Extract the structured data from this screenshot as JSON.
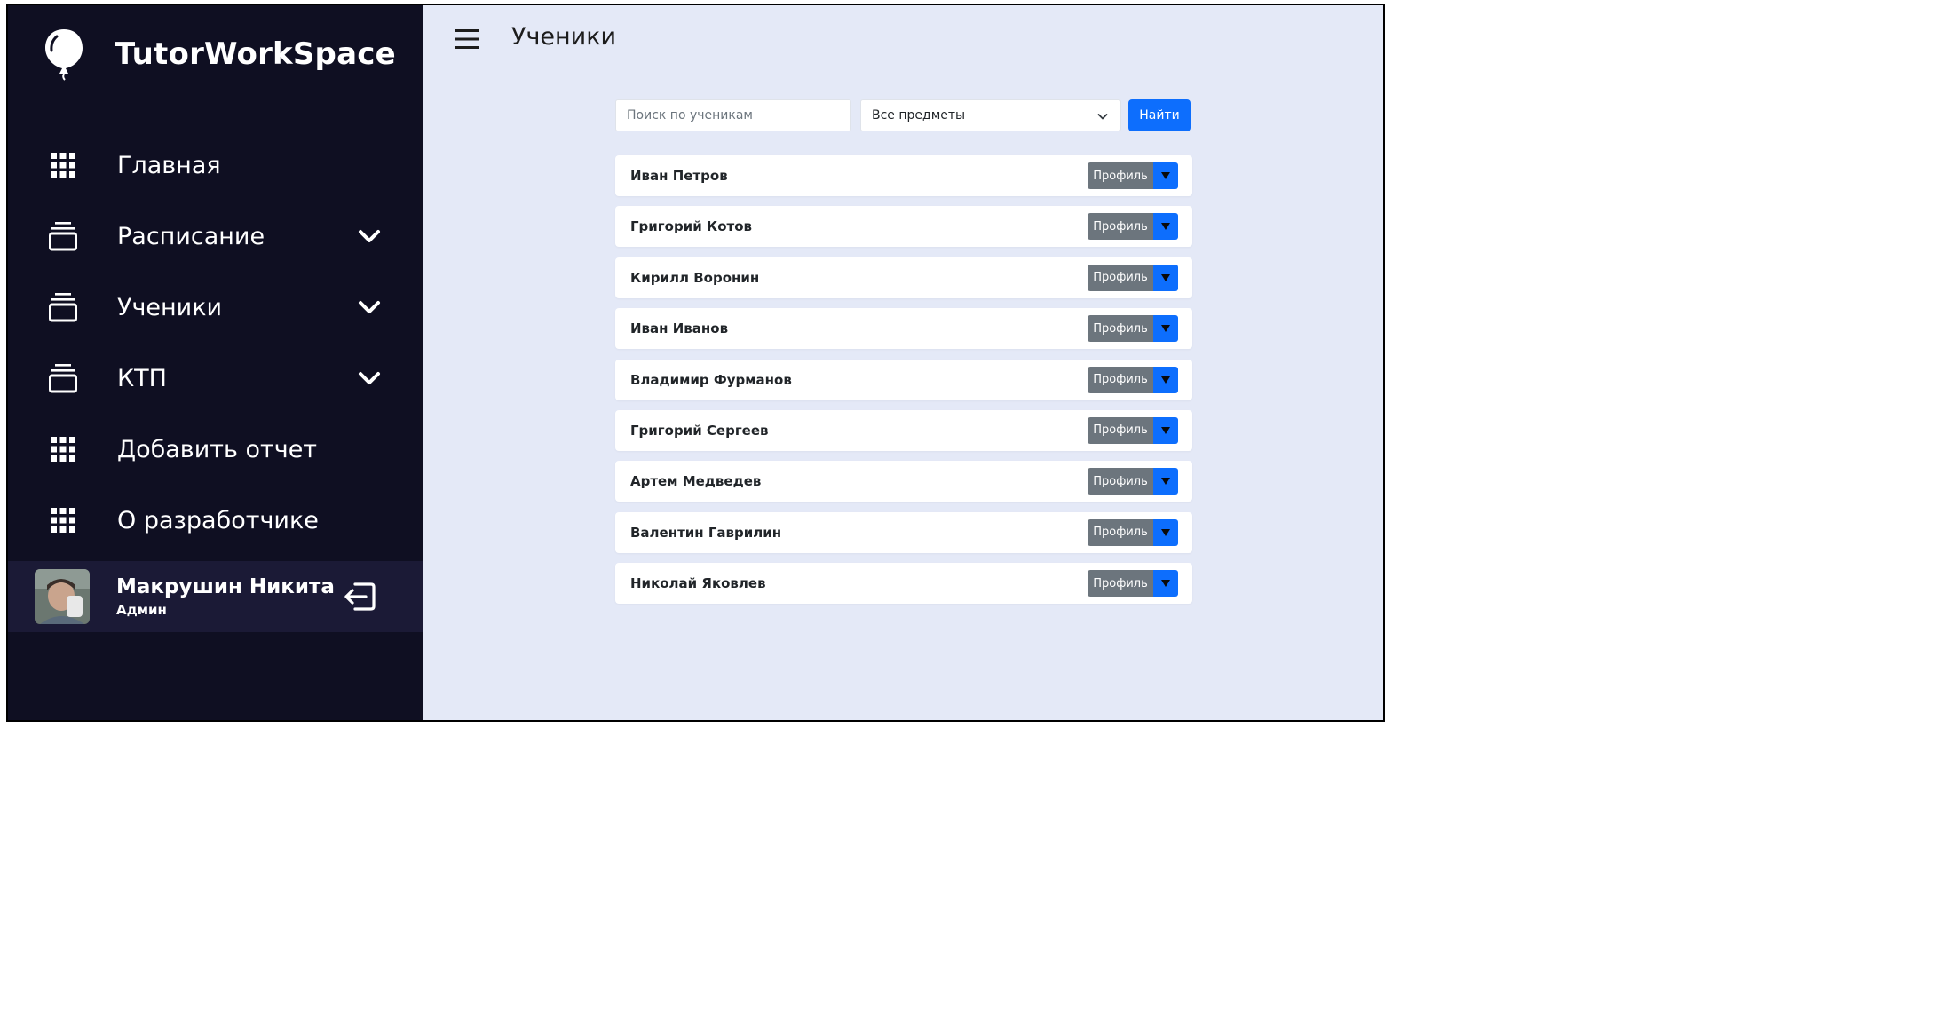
{
  "app": {
    "name": "TutorWorkSpace"
  },
  "sidebar": {
    "items": [
      {
        "label": "Главная",
        "icon": "grid-icon",
        "has_submenu": false
      },
      {
        "label": "Расписание",
        "icon": "stack-icon",
        "has_submenu": true
      },
      {
        "label": "Ученики",
        "icon": "stack-icon",
        "has_submenu": true
      },
      {
        "label": "КТП",
        "icon": "stack-icon",
        "has_submenu": true
      },
      {
        "label": "Добавить отчет",
        "icon": "grid-icon",
        "has_submenu": false
      },
      {
        "label": "О разработчике",
        "icon": "grid-icon",
        "has_submenu": false
      }
    ],
    "user": {
      "name": "Макрушин Никита",
      "role": "Админ"
    }
  },
  "header": {
    "title": "Ученики"
  },
  "search": {
    "placeholder": "Поиск по ученикам",
    "value": "",
    "subject_selected": "Все предметы",
    "submit_label": "Найти"
  },
  "students": [
    {
      "name": "Иван Петров",
      "action_label": "Профиль"
    },
    {
      "name": "Григорий Котов",
      "action_label": "Профиль"
    },
    {
      "name": "Кирилл Воронин",
      "action_label": "Профиль"
    },
    {
      "name": "Иван Иванов",
      "action_label": "Профиль"
    },
    {
      "name": "Владимир Фурманов",
      "action_label": "Профиль"
    },
    {
      "name": "Григорий Сергеев",
      "action_label": "Профиль"
    },
    {
      "name": "Артем Медведев",
      "action_label": "Профиль"
    },
    {
      "name": "Валентин Гаврилин",
      "action_label": "Профиль"
    },
    {
      "name": "Николай Яковлев",
      "action_label": "Профиль"
    }
  ],
  "colors": {
    "sidebar_bg": "#0f0f22",
    "sidebar_user_bg": "#1b1a36",
    "main_bg": "#e4e9f7",
    "primary": "#0d6efd",
    "secondary": "#6c757d"
  }
}
